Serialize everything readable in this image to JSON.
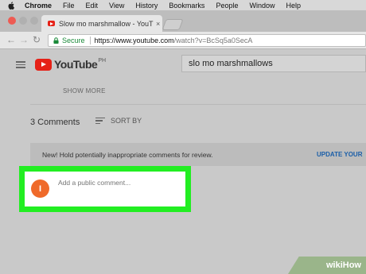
{
  "menubar": {
    "items": [
      "Chrome",
      "File",
      "Edit",
      "View",
      "History",
      "Bookmarks",
      "People",
      "Window",
      "Help"
    ]
  },
  "browser": {
    "tab_title": "Slow mo marshmallow - YouT",
    "tab_close": "×",
    "back_glyph": "←",
    "forward_glyph": "→",
    "reload_glyph": "↻",
    "secure_label": "Secure",
    "url_host": "https://www.youtube.com",
    "url_path": "/watch?v=BcSq5a0SecA"
  },
  "youtube": {
    "logo_text": "YouTube",
    "logo_region": "PH",
    "search_value": "slo mo marshmallows",
    "show_more": "SHOW MORE",
    "comments_count": "3 Comments",
    "sort_by": "SORT BY",
    "notice_text": "New! Hold potentially inappropriate comments for review.",
    "notice_action": "UPDATE YOUR",
    "avatar_initial": "I",
    "comment_placeholder": "Add a public comment..."
  },
  "watermark": {
    "wiki": "wiki",
    "how": "How"
  },
  "colors": {
    "highlight": "#22ee22",
    "avatar": "#ef6a2a",
    "youtube_red": "#e62117",
    "link_blue": "#1a5ea8",
    "secure_green": "#1b8a3a"
  }
}
